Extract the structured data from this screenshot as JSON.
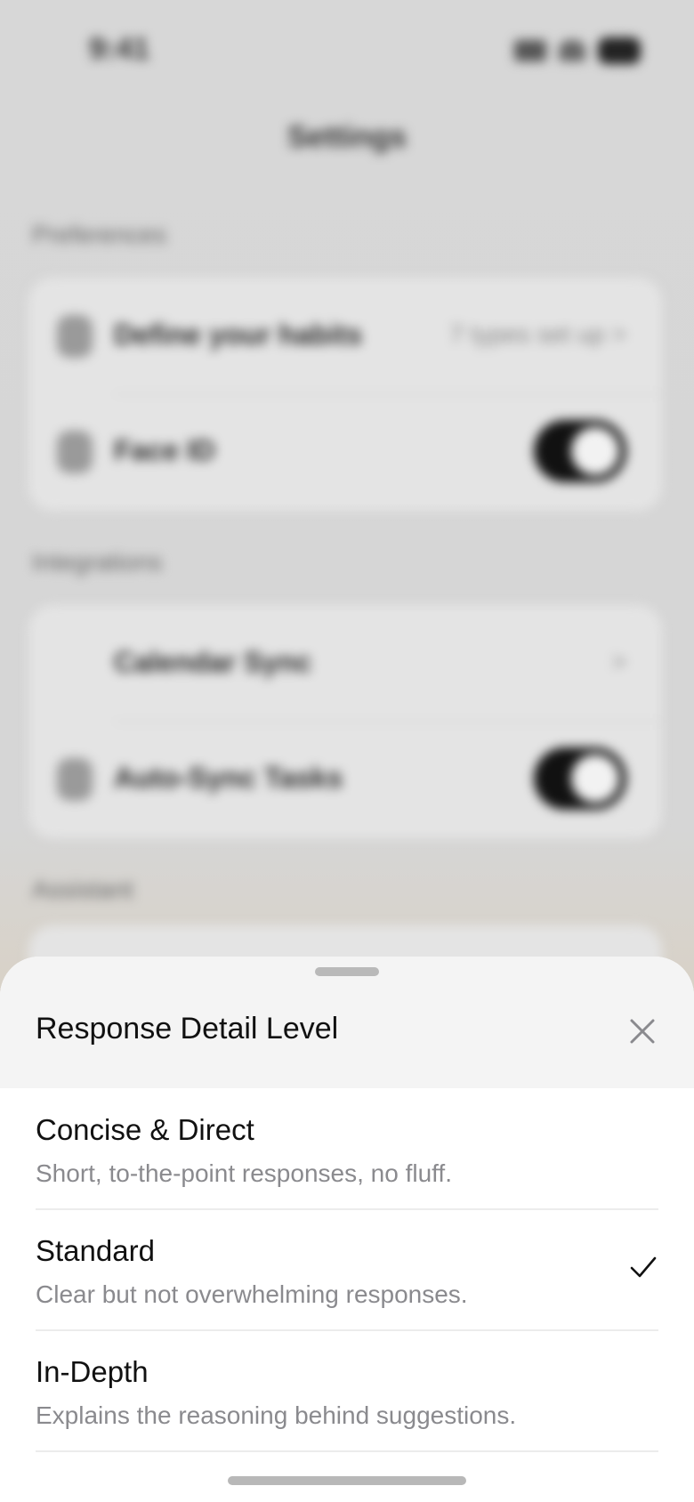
{
  "background": {
    "status_time": "9:41",
    "title": "Settings",
    "sections": [
      {
        "label": "Preferences",
        "rows": [
          {
            "label": "Define your habits",
            "value": "7 types set up >",
            "icon": "habit-icon"
          },
          {
            "label": "Face ID",
            "toggle_on": true,
            "icon": "face-id-icon"
          }
        ]
      },
      {
        "label": "Integrations",
        "rows": [
          {
            "label": "Calendar Sync",
            "value": ">",
            "icon": "calendar-icon"
          },
          {
            "label": "Auto-Sync Tasks",
            "toggle_on": true,
            "icon": "sync-icon"
          }
        ]
      },
      {
        "label": "Assistant"
      }
    ]
  },
  "sheet": {
    "title": "Response Detail Level",
    "close_icon": "close-icon",
    "options": [
      {
        "title": "Concise & Direct",
        "description": "Short, to-the-point responses, no fluff.",
        "selected": false
      },
      {
        "title": "Standard",
        "description": "Clear but not overwhelming responses.",
        "selected": true
      },
      {
        "title": "In-Depth",
        "description": "Explains the reasoning behind suggestions.",
        "selected": false
      }
    ],
    "check_icon": "checkmark-icon"
  },
  "colors": {
    "sheet_bg": "#ffffff",
    "sheet_header_bg": "#f4f4f4",
    "text_primary": "#111111",
    "text_secondary": "#8a8a8e",
    "toggle_on": "#111111"
  }
}
